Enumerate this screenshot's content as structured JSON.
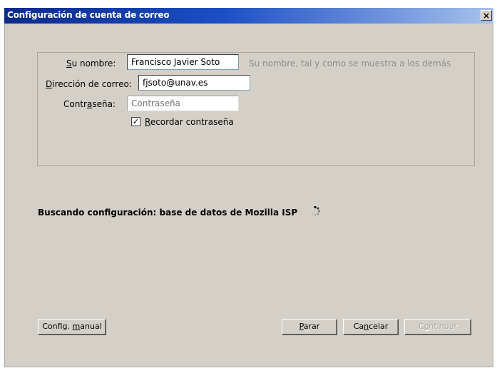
{
  "window": {
    "title": "Configuración de cuenta de correo",
    "close_label": "×"
  },
  "form": {
    "name_label_accel": "S",
    "name_label_rest": "u nombre:",
    "name_value": "Francisco Javier Soto",
    "name_hint": "Su nombre, tal y como se muestra a los demás",
    "email_label_accel": "D",
    "email_label_rest": "irección de correo:",
    "email_value": "fjsoto@unav.es",
    "password_label_pre": "Contr",
    "password_label_accel": "a",
    "password_label_post": "seña:",
    "password_placeholder": "Contraseña",
    "remember_checked": true,
    "remember_check_glyph": "✓",
    "remember_label_accel": "R",
    "remember_label_rest": "ecordar contraseña"
  },
  "status": {
    "text": "Buscando configuración: base de datos de Mozilla ISP"
  },
  "buttons": {
    "manual_pre": "Config. ",
    "manual_accel": "m",
    "manual_post": "anual",
    "stop_accel": "P",
    "stop_rest": "arar",
    "cancel_pre": "Ca",
    "cancel_accel": "n",
    "cancel_post": "celar",
    "continue_pre": "C",
    "continue_accel": "o",
    "continue_post": "ntinuar"
  },
  "colors": {
    "title_start": "#0a2a8c",
    "title_end": "#a7c2ec",
    "dialog_bg": "#d4d0c8"
  }
}
